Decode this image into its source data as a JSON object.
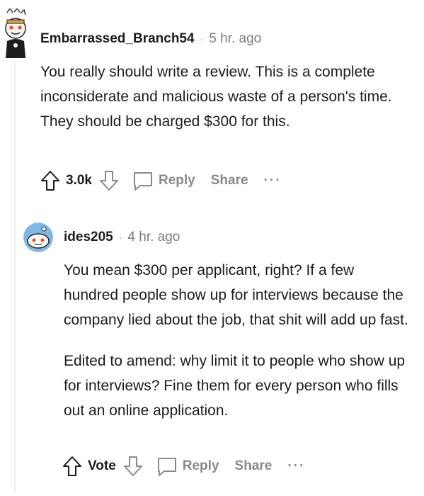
{
  "comments": [
    {
      "author": "Embarrassed_Branch54",
      "separator": "·",
      "time": "5 hr. ago",
      "paragraphs": [
        "You really should write a review. This is a complete inconsiderate and malicious waste of a person's time. They should be charged $300 for this."
      ],
      "vote": "3.0k",
      "reply_label": "Reply",
      "share_label": "Share",
      "more_label": "···"
    },
    {
      "author": "ides205",
      "separator": "·",
      "time": "4 hr. ago",
      "paragraphs": [
        "You mean $300 per applicant, right? If a few hundred people show up for interviews because the company lied about the job, that shit will add up fast.",
        "Edited to amend: why limit it to people who show up for interviews? Fine them for every person who fills out an online application."
      ],
      "vote": "Vote",
      "reply_label": "Reply",
      "share_label": "Share",
      "more_label": "···"
    }
  ],
  "colors": {
    "text": "#1c1c1c",
    "muted": "#878a8c",
    "thread_line": "#edeff1",
    "avatar2_bg": "#7fb8e8"
  },
  "icons": [
    "avatar-icon",
    "upvote-icon",
    "downvote-icon",
    "comment-icon",
    "more-icon"
  ]
}
